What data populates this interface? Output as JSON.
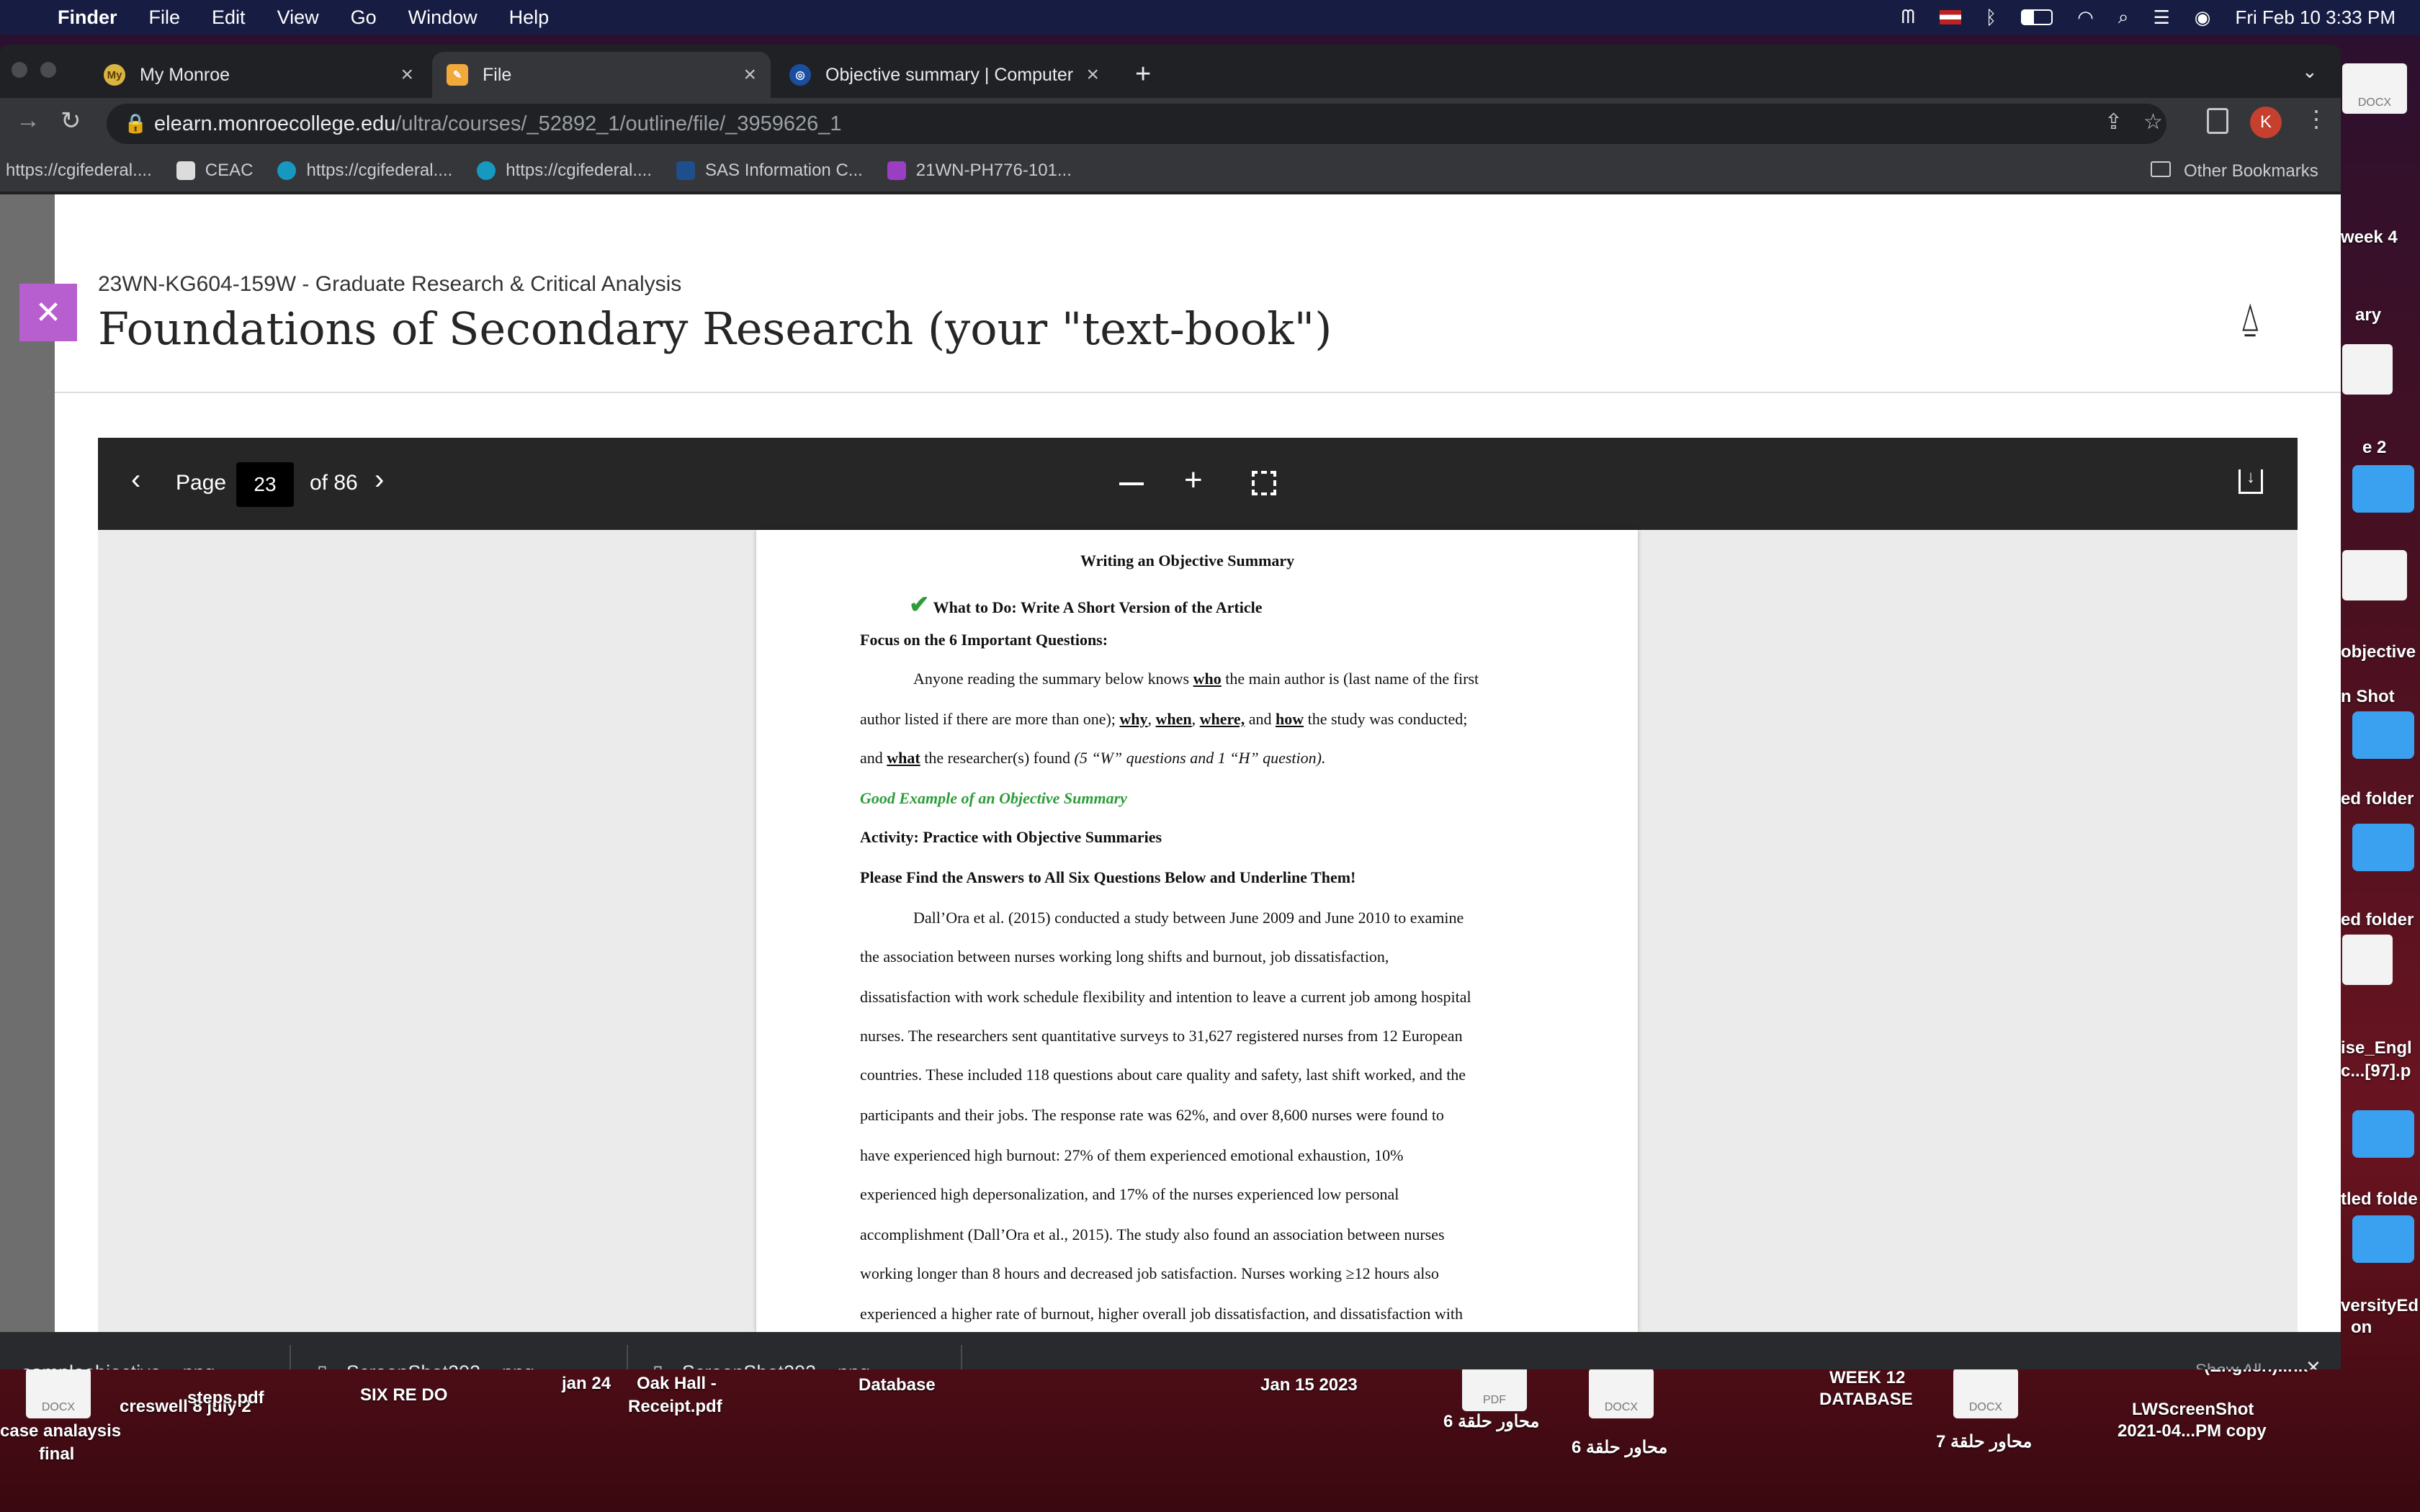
{
  "menubar": {
    "app": "Finder",
    "items": [
      "File",
      "Edit",
      "View",
      "Go",
      "Window",
      "Help"
    ],
    "datetime": "Fri Feb 10  3:33 PM"
  },
  "tabs": [
    {
      "favicon": "My",
      "title": "My Monroe"
    },
    {
      "favicon": "✎",
      "title": "File"
    },
    {
      "favicon": "◎",
      "title": "Objective summary | Computer"
    }
  ],
  "address": {
    "host": "elearn.monroecollege.edu",
    "path": "/ultra/courses/_52892_1/outline/file/_3959626_1"
  },
  "profile_initial": "K",
  "bookmarks": [
    "https://cgifederal....",
    "CEAC",
    "https://cgifederal....",
    "https://cgifederal....",
    "SAS Information C...",
    "21WN-PH776-101..."
  ],
  "other_bookmarks": "Other Bookmarks",
  "course": "23WN-KG604-159W - Graduate Research & Critical Analysis",
  "doc_title": "Foundations of Secondary Research (your \"text-book\")",
  "viewer": {
    "page_label": "Page",
    "page_number": "23",
    "of_label": "of 86"
  },
  "document": {
    "heading": "Writing an Objective Summary",
    "what_to_do": "What to Do: Write A Short Version of the Article",
    "focus": "Focus on the 6 Important Questions:",
    "p1": {
      "a": "Anyone reading the summary below knows ",
      "who": "who",
      "b": " the main author is (last name of the first",
      "line2a": "author listed if there are more than one); ",
      "why": "why",
      "when": "when",
      "where": "where,",
      "and": " and ",
      "how": "how",
      "line2b": " the study was conducted;",
      "line3a": "and ",
      "what": "what",
      "line3b": " the researcher(s) found ",
      "line3c": "(5 “W” questions and 1 “H” question)."
    },
    "good_example": "Good Example of an Objective Summary",
    "activity": "Activity: Practice with Objective Summaries",
    "please_find": "Please Find the Answers to All Six Questions Below and Underline Them!",
    "body_lines": [
      "Dall’Ora et al. (2015) conducted a study between June 2009 and June 2010 to examine",
      "the association between nurses working long shifts and burnout, job dissatisfaction,",
      "dissatisfaction with work schedule flexibility and intention to leave a current job among hospital",
      "nurses. The researchers sent quantitative surveys to 31,627 registered nurses from 12 European",
      "countries. These included 118 questions about care quality and safety, last shift worked, and the",
      "participants and their jobs. The response rate was 62%, and over 8,600 nurses were found to",
      "have experienced high burnout: 27% of them experienced emotional exhaustion, 10%",
      "experienced high depersonalization, and 17% of the nurses experienced low personal",
      "accomplishment (Dall’Ora et al., 2015). The study also found an association between nurses",
      "working longer than 8 hours and decreased job satisfaction. Nurses working ≥12 hours also",
      "experienced a higher rate of burnout, higher overall job dissatisfaction, and dissatisfaction with"
    ]
  },
  "downloads": [
    "sampleobjective....png",
    "ScreenShot202....png",
    "ScreenShot202....png"
  ],
  "show_all": "Show All",
  "desktop_labels": {
    "week4": "week 4",
    "ary": "ary",
    "e2": "e 2",
    "objective": "objective",
    "shot": "n Shot",
    "folder1": "ed folder",
    "folder2": "ed folder",
    "engl": "ise_Engl",
    "c97": "c...[97].p",
    "folder3": "tled folde",
    "versity": "versityEd",
    "on": "on",
    "case": "case analaysis",
    "final": "final",
    "creswell": "creswell 8 july 2",
    "steps": "steps.pdf",
    "sixre": "SIX RE DO",
    "jan24": "jan 24",
    "oakhall": "Oak Hall -",
    "receipt": "Receipt.pdf",
    "database": "Database",
    "jan15": "Jan 15 2023",
    "arabic6a": "محاور حلقة 6",
    "arabic6b": "محاور حلقة 6",
    "week12": "WEEK 12",
    "week12b": "DATABASE",
    "arabic7": "محاور حلقة 7",
    "lw1": "LWScreenShot",
    "lw2": "2021-04...PM copy",
    "english": "(English).lnk",
    "docx": "DOCX",
    "pdf": "PDF"
  }
}
